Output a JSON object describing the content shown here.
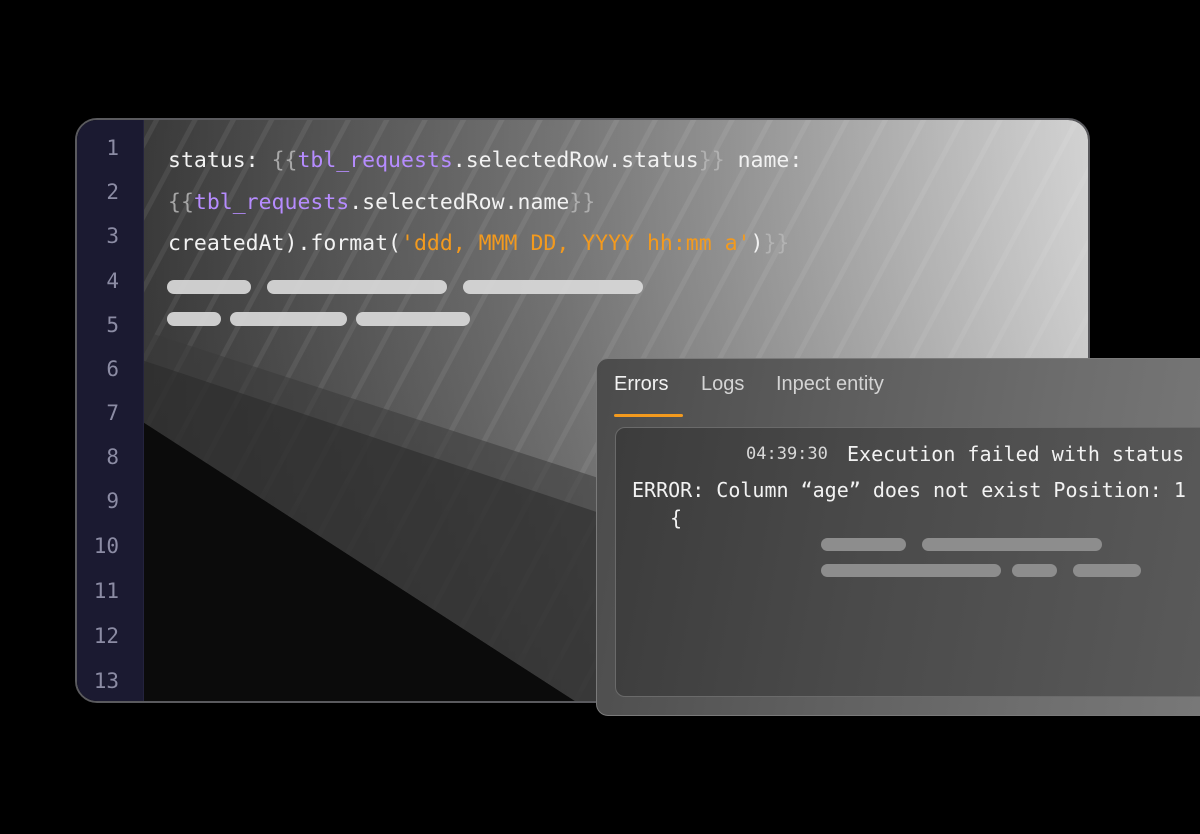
{
  "editor": {
    "line_numbers": [
      "1",
      "2",
      "3",
      "4",
      "5",
      "6",
      "7",
      "8",
      "9",
      "10",
      "11",
      "12",
      "13"
    ],
    "code": {
      "line1": {
        "key": "status: ",
        "open": "{{",
        "var": "tbl_requests",
        "rest": ".selectedRow.status",
        "close": "}}",
        "tail": " name:"
      },
      "line2": {
        "open": "{{",
        "var": "tbl_requests",
        "rest": ".selectedRow.name",
        "close": "}}"
      },
      "line3": {
        "pre": "createdAt).format(",
        "str": "'ddd, MMM DD, YYYY hh:mm a'",
        "post": ")",
        "close": "}}"
      }
    }
  },
  "console": {
    "tabs": [
      {
        "label": "Errors",
        "active": true
      },
      {
        "label": "Logs",
        "active": false
      },
      {
        "label": "Inpect entity",
        "active": false
      }
    ],
    "log": {
      "time": "04:39:30",
      "message": "Execution failed with status",
      "error": "ERROR: Column “age” does not exist Position: 1",
      "brace": "{"
    }
  },
  "colors": {
    "background": "#000000",
    "gutter": "#1b1a31",
    "variable": "#b68cff",
    "string": "#f39a1e",
    "active_tab_underline": "#f39a1e"
  }
}
